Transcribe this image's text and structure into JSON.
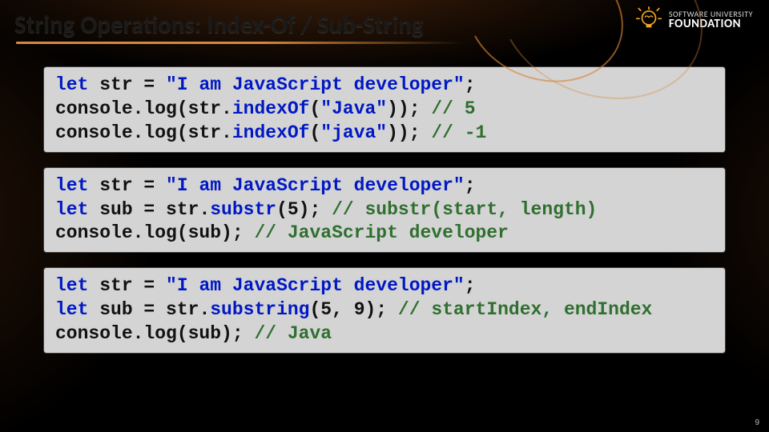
{
  "title": "String Operations: Index-Of / Sub-String",
  "logo": {
    "line1": "SOFTWARE UNIVERSITY",
    "line2": "FOUNDATION"
  },
  "pageNumber": "9",
  "code1": {
    "l1": {
      "kw": "let",
      "a": " str = ",
      "s": "\"I am JavaScript developer\"",
      "b": ";"
    },
    "l2": {
      "a": "console.log(str.",
      "fn": "indexOf",
      "b": "(",
      "s": "\"Java\"",
      "c": ")); ",
      "cm": "// 5"
    },
    "l3": {
      "a": "console.log(str.",
      "fn": "indexOf",
      "b": "(",
      "s": "\"java\"",
      "c": ")); ",
      "cm": "// -1"
    }
  },
  "code2": {
    "l1": {
      "kw": "let",
      "a": " str = ",
      "s": "\"I am JavaScript developer\"",
      "b": ";"
    },
    "l2": {
      "kw": "let",
      "a": " sub = str.",
      "fn": "substr",
      "b": "(5); ",
      "cm": "// substr(start, length)"
    },
    "l3": {
      "a": "console.log(sub); ",
      "cm": "// JavaScript developer"
    }
  },
  "code3": {
    "l1": {
      "kw": "let",
      "a": " str = ",
      "s": "\"I am JavaScript developer\"",
      "b": ";"
    },
    "l2": {
      "kw": "let",
      "a": " sub = str.",
      "fn": "substring",
      "b": "(5, 9); ",
      "cm": "// startIndex, endIndex"
    },
    "l3": {
      "a": "console.log(sub); ",
      "cm": "// Java"
    }
  }
}
